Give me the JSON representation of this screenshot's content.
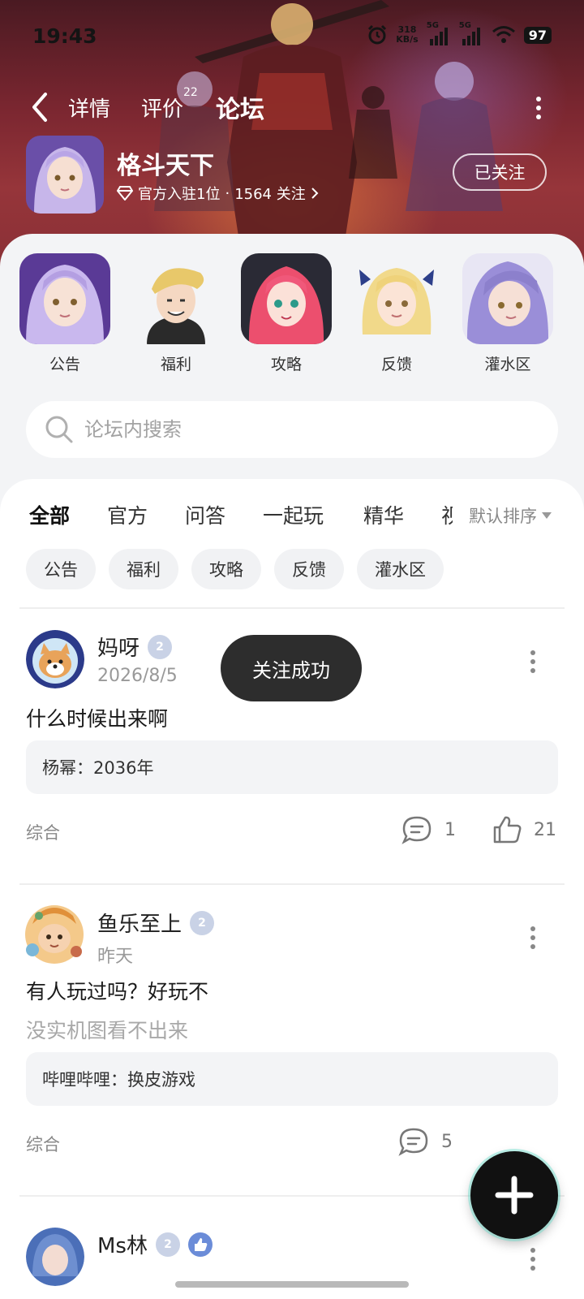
{
  "status_bar": {
    "time": "19:43",
    "net_speed_value": "318",
    "net_speed_unit": "KB/s",
    "signal_1": "5G",
    "signal_2": "5G",
    "battery": "97"
  },
  "nav": {
    "tabs": [
      {
        "label": "详情"
      },
      {
        "label": "评价",
        "badge": "22"
      },
      {
        "label": "论坛"
      }
    ],
    "active_tab": "论坛"
  },
  "game": {
    "title": "格斗天下",
    "rank_text": "官方入驻1位",
    "followers_text": "1564 关注",
    "follow_button": "已关注"
  },
  "categories": [
    {
      "label": "公告"
    },
    {
      "label": "福利"
    },
    {
      "label": "攻略"
    },
    {
      "label": "反馈"
    },
    {
      "label": "灌水区"
    }
  ],
  "search": {
    "placeholder": "论坛内搜索"
  },
  "filter_tabs": [
    {
      "label": "全部"
    },
    {
      "label": "官方"
    },
    {
      "label": "问答"
    },
    {
      "label": "一起玩"
    },
    {
      "label": "精华"
    },
    {
      "label": "视"
    }
  ],
  "sort": {
    "label": "默认排序"
  },
  "chips": [
    {
      "label": "公告"
    },
    {
      "label": "福利"
    },
    {
      "label": "攻略"
    },
    {
      "label": "反馈"
    },
    {
      "label": "灌水区"
    }
  ],
  "posts": [
    {
      "user": "妈呀",
      "level": "2",
      "date": "2026/8/5",
      "title": "什么时候出来啊",
      "reply": "杨幂：2036年",
      "tag": "综合",
      "comments": "1",
      "likes": "21"
    },
    {
      "user": "鱼乐至上",
      "level": "2",
      "date": "昨天",
      "title": "有人玩过吗？好玩不",
      "subtitle": "没实机图看不出来",
      "reply": "哔哩哔哩：换皮游戏",
      "tag": "综合",
      "comments": "5"
    },
    {
      "user": "Ms林",
      "level": "2"
    }
  ],
  "toast": "关注成功",
  "colors": {
    "accent": "#3fd6b8",
    "hero_bg": "#8a3036",
    "sheet_bg": "#f3f4f6",
    "toast_bg": "#2d2d2d"
  }
}
